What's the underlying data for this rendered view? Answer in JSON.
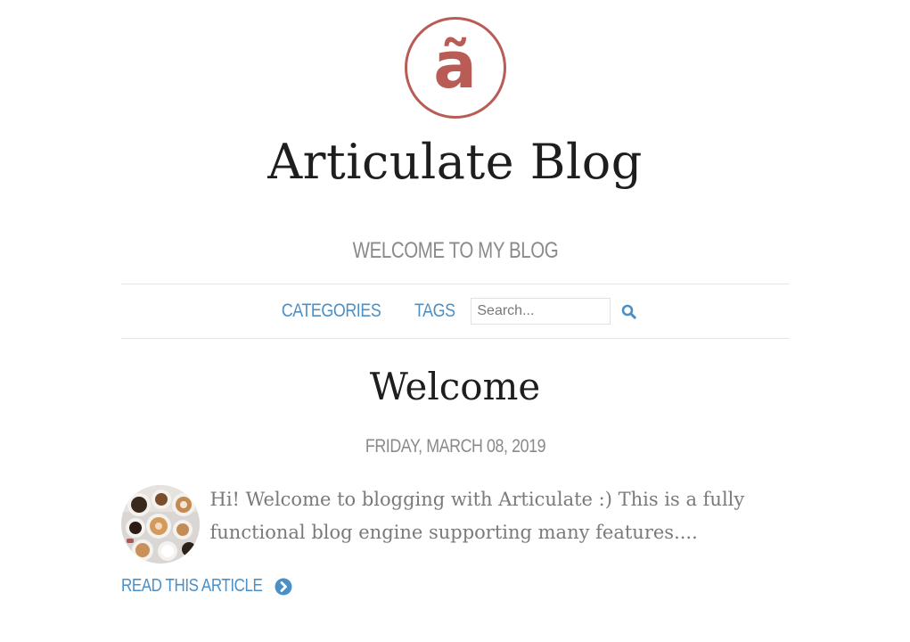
{
  "site": {
    "logo_glyph": "ã",
    "title": "Articulate Blog",
    "tagline": "WELCOME TO MY BLOG",
    "brand_color": "#b85c55",
    "link_color": "#4a90c8"
  },
  "nav": {
    "categories_label": "CATEGORIES",
    "tags_label": "TAGS",
    "search_placeholder": "Search...",
    "search_icon": "search-icon"
  },
  "post": {
    "title": "Welcome",
    "date": "FRIDAY, MARCH 08, 2019",
    "excerpt": "Hi! Welcome to blogging with Articulate :) This is a fully functional blog engine supporting many features....",
    "read_more_label": "READ THIS ARTICLE",
    "read_more_icon": "chevron-right-circle-icon",
    "thumbnail": "coffee-cups-photo"
  }
}
